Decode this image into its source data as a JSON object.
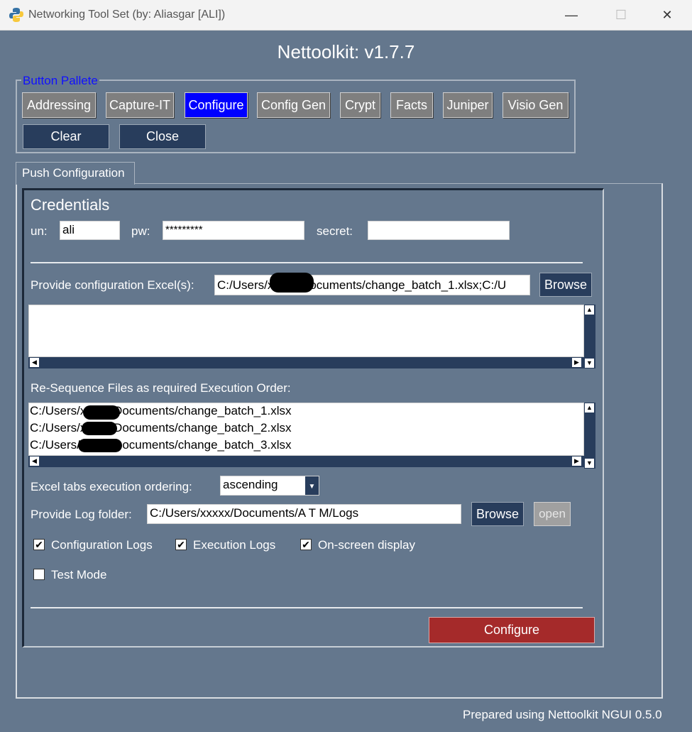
{
  "window": {
    "title": "Networking Tool Set  (by: Aliasgar [ALI])",
    "min_glyph": "—",
    "max_glyph": "☐",
    "close_glyph": "✕"
  },
  "app_title": "Nettoolkit: v1.7.7",
  "palette": {
    "legend": "Button Pallete",
    "buttons": [
      "Addressing",
      "Capture-IT",
      "Configure",
      "Config Gen",
      "Crypt",
      "Facts",
      "Juniper",
      "Visio Gen"
    ],
    "active": "Configure",
    "active_color": "#0000ff",
    "clear_label": "Clear",
    "close_label": "Close"
  },
  "tab": {
    "label": "Push Configuration"
  },
  "credentials": {
    "heading": "Credentials",
    "un_label": "un:",
    "un_value": "ali",
    "pw_label": "pw:",
    "pw_value": "*********",
    "secret_label": "secret:",
    "secret_value": ""
  },
  "excel": {
    "label": "Provide configuration Excel(s):",
    "value": "C:/Users/xxxxx/Documents/change_batch_1.xlsx;C:/U",
    "browse_label": "Browse"
  },
  "resequence": {
    "label": "Re-Sequence Files as required Execution Order:",
    "items": [
      "C:/Users/xxxxx/Documents/change_batch_1.xlsx",
      "C:/Users/xxxxx/Documents/change_batch_2.xlsx",
      "C:/Users/xxxxx/Documents/change_batch_3.xlsx"
    ]
  },
  "ordering": {
    "label": "Excel tabs execution ordering:",
    "value": "ascending"
  },
  "log_folder": {
    "label": "Provide Log folder:",
    "value": "C:/Users/xxxxx/Documents/A T M/Logs",
    "browse_label": "Browse",
    "open_label": "open"
  },
  "options": {
    "configuration_logs": {
      "label": "Configuration Logs",
      "checked": true
    },
    "execution_logs": {
      "label": "Execution Logs",
      "checked": true
    },
    "onscreen_display": {
      "label": "On-screen display",
      "checked": true
    },
    "test_mode": {
      "label": "Test Mode",
      "checked": false
    }
  },
  "configure_label": "Configure",
  "configure_color": "#a52a2a",
  "footer": "Prepared using Nettoolkit NGUI 0.5.0"
}
